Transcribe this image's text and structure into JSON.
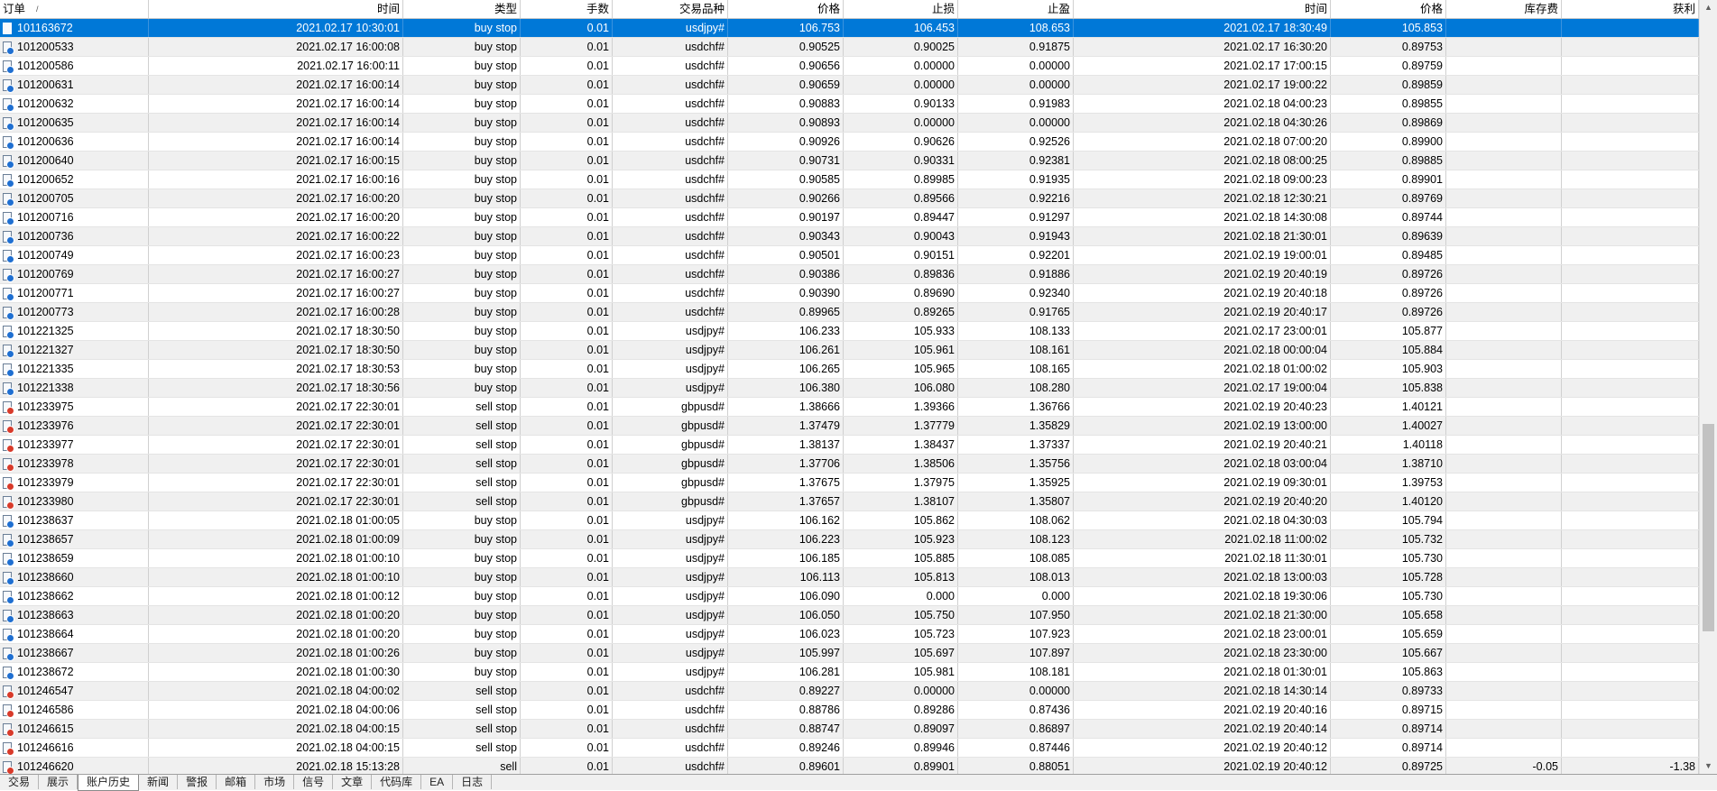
{
  "columns": [
    "订单",
    "时间",
    "类型",
    "手数",
    "交易品种",
    "价格",
    "止损",
    "止盈",
    "时间",
    "价格",
    "库存费",
    "获利"
  ],
  "sort_indicator": "/",
  "sort_icon": "sort-ascending-icon",
  "rows": [
    {
      "order": "101163672",
      "open_time": "2021.02.17 10:30:01",
      "type": "buy stop",
      "lots": "0.01",
      "symbol": "usdjpy#",
      "price": "106.753",
      "sl": "106.453",
      "tp": "108.653",
      "close_time": "2021.02.17 18:30:49",
      "close_price": "105.853",
      "swap": "",
      "profit": "",
      "icon": "none",
      "selected": true
    },
    {
      "order": "101200533",
      "open_time": "2021.02.17 16:00:08",
      "type": "buy stop",
      "lots": "0.01",
      "symbol": "usdchf#",
      "price": "0.90525",
      "sl": "0.90025",
      "tp": "0.91875",
      "close_time": "2021.02.17 16:30:20",
      "close_price": "0.89753",
      "swap": "",
      "profit": "",
      "icon": "buy"
    },
    {
      "order": "101200586",
      "open_time": "2021.02.17 16:00:11",
      "type": "buy stop",
      "lots": "0.01",
      "symbol": "usdchf#",
      "price": "0.90656",
      "sl": "0.00000",
      "tp": "0.00000",
      "close_time": "2021.02.17 17:00:15",
      "close_price": "0.89759",
      "swap": "",
      "profit": "",
      "icon": "buy"
    },
    {
      "order": "101200631",
      "open_time": "2021.02.17 16:00:14",
      "type": "buy stop",
      "lots": "0.01",
      "symbol": "usdchf#",
      "price": "0.90659",
      "sl": "0.00000",
      "tp": "0.00000",
      "close_time": "2021.02.17 19:00:22",
      "close_price": "0.89859",
      "swap": "",
      "profit": "",
      "icon": "buy"
    },
    {
      "order": "101200632",
      "open_time": "2021.02.17 16:00:14",
      "type": "buy stop",
      "lots": "0.01",
      "symbol": "usdchf#",
      "price": "0.90883",
      "sl": "0.90133",
      "tp": "0.91983",
      "close_time": "2021.02.18 04:00:23",
      "close_price": "0.89855",
      "swap": "",
      "profit": "",
      "icon": "buy"
    },
    {
      "order": "101200635",
      "open_time": "2021.02.17 16:00:14",
      "type": "buy stop",
      "lots": "0.01",
      "symbol": "usdchf#",
      "price": "0.90893",
      "sl": "0.00000",
      "tp": "0.00000",
      "close_time": "2021.02.18 04:30:26",
      "close_price": "0.89869",
      "swap": "",
      "profit": "",
      "icon": "buy"
    },
    {
      "order": "101200636",
      "open_time": "2021.02.17 16:00:14",
      "type": "buy stop",
      "lots": "0.01",
      "symbol": "usdchf#",
      "price": "0.90926",
      "sl": "0.90626",
      "tp": "0.92526",
      "close_time": "2021.02.18 07:00:20",
      "close_price": "0.89900",
      "swap": "",
      "profit": "",
      "icon": "buy"
    },
    {
      "order": "101200640",
      "open_time": "2021.02.17 16:00:15",
      "type": "buy stop",
      "lots": "0.01",
      "symbol": "usdchf#",
      "price": "0.90731",
      "sl": "0.90331",
      "tp": "0.92381",
      "close_time": "2021.02.18 08:00:25",
      "close_price": "0.89885",
      "swap": "",
      "profit": "",
      "icon": "buy"
    },
    {
      "order": "101200652",
      "open_time": "2021.02.17 16:00:16",
      "type": "buy stop",
      "lots": "0.01",
      "symbol": "usdchf#",
      "price": "0.90585",
      "sl": "0.89985",
      "tp": "0.91935",
      "close_time": "2021.02.18 09:00:23",
      "close_price": "0.89901",
      "swap": "",
      "profit": "",
      "icon": "buy"
    },
    {
      "order": "101200705",
      "open_time": "2021.02.17 16:00:20",
      "type": "buy stop",
      "lots": "0.01",
      "symbol": "usdchf#",
      "price": "0.90266",
      "sl": "0.89566",
      "tp": "0.92216",
      "close_time": "2021.02.18 12:30:21",
      "close_price": "0.89769",
      "swap": "",
      "profit": "",
      "icon": "buy"
    },
    {
      "order": "101200716",
      "open_time": "2021.02.17 16:00:20",
      "type": "buy stop",
      "lots": "0.01",
      "symbol": "usdchf#",
      "price": "0.90197",
      "sl": "0.89447",
      "tp": "0.91297",
      "close_time": "2021.02.18 14:30:08",
      "close_price": "0.89744",
      "swap": "",
      "profit": "",
      "icon": "buy"
    },
    {
      "order": "101200736",
      "open_time": "2021.02.17 16:00:22",
      "type": "buy stop",
      "lots": "0.01",
      "symbol": "usdchf#",
      "price": "0.90343",
      "sl": "0.90043",
      "tp": "0.91943",
      "close_time": "2021.02.18 21:30:01",
      "close_price": "0.89639",
      "swap": "",
      "profit": "",
      "icon": "buy"
    },
    {
      "order": "101200749",
      "open_time": "2021.02.17 16:00:23",
      "type": "buy stop",
      "lots": "0.01",
      "symbol": "usdchf#",
      "price": "0.90501",
      "sl": "0.90151",
      "tp": "0.92201",
      "close_time": "2021.02.19 19:00:01",
      "close_price": "0.89485",
      "swap": "",
      "profit": "",
      "icon": "buy"
    },
    {
      "order": "101200769",
      "open_time": "2021.02.17 16:00:27",
      "type": "buy stop",
      "lots": "0.01",
      "symbol": "usdchf#",
      "price": "0.90386",
      "sl": "0.89836",
      "tp": "0.91886",
      "close_time": "2021.02.19 20:40:19",
      "close_price": "0.89726",
      "swap": "",
      "profit": "",
      "icon": "buy"
    },
    {
      "order": "101200771",
      "open_time": "2021.02.17 16:00:27",
      "type": "buy stop",
      "lots": "0.01",
      "symbol": "usdchf#",
      "price": "0.90390",
      "sl": "0.89690",
      "tp": "0.92340",
      "close_time": "2021.02.19 20:40:18",
      "close_price": "0.89726",
      "swap": "",
      "profit": "",
      "icon": "buy"
    },
    {
      "order": "101200773",
      "open_time": "2021.02.17 16:00:28",
      "type": "buy stop",
      "lots": "0.01",
      "symbol": "usdchf#",
      "price": "0.89965",
      "sl": "0.89265",
      "tp": "0.91765",
      "close_time": "2021.02.19 20:40:17",
      "close_price": "0.89726",
      "swap": "",
      "profit": "",
      "icon": "buy"
    },
    {
      "order": "101221325",
      "open_time": "2021.02.17 18:30:50",
      "type": "buy stop",
      "lots": "0.01",
      "symbol": "usdjpy#",
      "price": "106.233",
      "sl": "105.933",
      "tp": "108.133",
      "close_time": "2021.02.17 23:00:01",
      "close_price": "105.877",
      "swap": "",
      "profit": "",
      "icon": "buy"
    },
    {
      "order": "101221327",
      "open_time": "2021.02.17 18:30:50",
      "type": "buy stop",
      "lots": "0.01",
      "symbol": "usdjpy#",
      "price": "106.261",
      "sl": "105.961",
      "tp": "108.161",
      "close_time": "2021.02.18 00:00:04",
      "close_price": "105.884",
      "swap": "",
      "profit": "",
      "icon": "buy"
    },
    {
      "order": "101221335",
      "open_time": "2021.02.17 18:30:53",
      "type": "buy stop",
      "lots": "0.01",
      "symbol": "usdjpy#",
      "price": "106.265",
      "sl": "105.965",
      "tp": "108.165",
      "close_time": "2021.02.18 01:00:02",
      "close_price": "105.903",
      "swap": "",
      "profit": "",
      "icon": "buy"
    },
    {
      "order": "101221338",
      "open_time": "2021.02.17 18:30:56",
      "type": "buy stop",
      "lots": "0.01",
      "symbol": "usdjpy#",
      "price": "106.380",
      "sl": "106.080",
      "tp": "108.280",
      "close_time": "2021.02.17 19:00:04",
      "close_price": "105.838",
      "swap": "",
      "profit": "",
      "icon": "buy"
    },
    {
      "order": "101233975",
      "open_time": "2021.02.17 22:30:01",
      "type": "sell stop",
      "lots": "0.01",
      "symbol": "gbpusd#",
      "price": "1.38666",
      "sl": "1.39366",
      "tp": "1.36766",
      "close_time": "2021.02.19 20:40:23",
      "close_price": "1.40121",
      "swap": "",
      "profit": "",
      "icon": "sell"
    },
    {
      "order": "101233976",
      "open_time": "2021.02.17 22:30:01",
      "type": "sell stop",
      "lots": "0.01",
      "symbol": "gbpusd#",
      "price": "1.37479",
      "sl": "1.37779",
      "tp": "1.35829",
      "close_time": "2021.02.19 13:00:00",
      "close_price": "1.40027",
      "swap": "",
      "profit": "",
      "icon": "sell"
    },
    {
      "order": "101233977",
      "open_time": "2021.02.17 22:30:01",
      "type": "sell stop",
      "lots": "0.01",
      "symbol": "gbpusd#",
      "price": "1.38137",
      "sl": "1.38437",
      "tp": "1.37337",
      "close_time": "2021.02.19 20:40:21",
      "close_price": "1.40118",
      "swap": "",
      "profit": "",
      "icon": "sell"
    },
    {
      "order": "101233978",
      "open_time": "2021.02.17 22:30:01",
      "type": "sell stop",
      "lots": "0.01",
      "symbol": "gbpusd#",
      "price": "1.37706",
      "sl": "1.38506",
      "tp": "1.35756",
      "close_time": "2021.02.18 03:00:04",
      "close_price": "1.38710",
      "swap": "",
      "profit": "",
      "icon": "sell"
    },
    {
      "order": "101233979",
      "open_time": "2021.02.17 22:30:01",
      "type": "sell stop",
      "lots": "0.01",
      "symbol": "gbpusd#",
      "price": "1.37675",
      "sl": "1.37975",
      "tp": "1.35925",
      "close_time": "2021.02.19 09:30:01",
      "close_price": "1.39753",
      "swap": "",
      "profit": "",
      "icon": "sell"
    },
    {
      "order": "101233980",
      "open_time": "2021.02.17 22:30:01",
      "type": "sell stop",
      "lots": "0.01",
      "symbol": "gbpusd#",
      "price": "1.37657",
      "sl": "1.38107",
      "tp": "1.35807",
      "close_time": "2021.02.19 20:40:20",
      "close_price": "1.40120",
      "swap": "",
      "profit": "",
      "icon": "sell"
    },
    {
      "order": "101238637",
      "open_time": "2021.02.18 01:00:05",
      "type": "buy stop",
      "lots": "0.01",
      "symbol": "usdjpy#",
      "price": "106.162",
      "sl": "105.862",
      "tp": "108.062",
      "close_time": "2021.02.18 04:30:03",
      "close_price": "105.794",
      "swap": "",
      "profit": "",
      "icon": "buy"
    },
    {
      "order": "101238657",
      "open_time": "2021.02.18 01:00:09",
      "type": "buy stop",
      "lots": "0.01",
      "symbol": "usdjpy#",
      "price": "106.223",
      "sl": "105.923",
      "tp": "108.123",
      "close_time": "2021.02.18 11:00:02",
      "close_price": "105.732",
      "swap": "",
      "profit": "",
      "icon": "buy"
    },
    {
      "order": "101238659",
      "open_time": "2021.02.18 01:00:10",
      "type": "buy stop",
      "lots": "0.01",
      "symbol": "usdjpy#",
      "price": "106.185",
      "sl": "105.885",
      "tp": "108.085",
      "close_time": "2021.02.18 11:30:01",
      "close_price": "105.730",
      "swap": "",
      "profit": "",
      "icon": "buy"
    },
    {
      "order": "101238660",
      "open_time": "2021.02.18 01:00:10",
      "type": "buy stop",
      "lots": "0.01",
      "symbol": "usdjpy#",
      "price": "106.113",
      "sl": "105.813",
      "tp": "108.013",
      "close_time": "2021.02.18 13:00:03",
      "close_price": "105.728",
      "swap": "",
      "profit": "",
      "icon": "buy"
    },
    {
      "order": "101238662",
      "open_time": "2021.02.18 01:00:12",
      "type": "buy stop",
      "lots": "0.01",
      "symbol": "usdjpy#",
      "price": "106.090",
      "sl": "0.000",
      "tp": "0.000",
      "close_time": "2021.02.18 19:30:06",
      "close_price": "105.730",
      "swap": "",
      "profit": "",
      "icon": "buy"
    },
    {
      "order": "101238663",
      "open_time": "2021.02.18 01:00:20",
      "type": "buy stop",
      "lots": "0.01",
      "symbol": "usdjpy#",
      "price": "106.050",
      "sl": "105.750",
      "tp": "107.950",
      "close_time": "2021.02.18 21:30:00",
      "close_price": "105.658",
      "swap": "",
      "profit": "",
      "icon": "buy"
    },
    {
      "order": "101238664",
      "open_time": "2021.02.18 01:00:20",
      "type": "buy stop",
      "lots": "0.01",
      "symbol": "usdjpy#",
      "price": "106.023",
      "sl": "105.723",
      "tp": "107.923",
      "close_time": "2021.02.18 23:00:01",
      "close_price": "105.659",
      "swap": "",
      "profit": "",
      "icon": "buy"
    },
    {
      "order": "101238667",
      "open_time": "2021.02.18 01:00:26",
      "type": "buy stop",
      "lots": "0.01",
      "symbol": "usdjpy#",
      "price": "105.997",
      "sl": "105.697",
      "tp": "107.897",
      "close_time": "2021.02.18 23:30:00",
      "close_price": "105.667",
      "swap": "",
      "profit": "",
      "icon": "buy"
    },
    {
      "order": "101238672",
      "open_time": "2021.02.18 01:00:30",
      "type": "buy stop",
      "lots": "0.01",
      "symbol": "usdjpy#",
      "price": "106.281",
      "sl": "105.981",
      "tp": "108.181",
      "close_time": "2021.02.18 01:30:01",
      "close_price": "105.863",
      "swap": "",
      "profit": "",
      "icon": "buy"
    },
    {
      "order": "101246547",
      "open_time": "2021.02.18 04:00:02",
      "type": "sell stop",
      "lots": "0.01",
      "symbol": "usdchf#",
      "price": "0.89227",
      "sl": "0.00000",
      "tp": "0.00000",
      "close_time": "2021.02.18 14:30:14",
      "close_price": "0.89733",
      "swap": "",
      "profit": "",
      "icon": "sell"
    },
    {
      "order": "101246586",
      "open_time": "2021.02.18 04:00:06",
      "type": "sell stop",
      "lots": "0.01",
      "symbol": "usdchf#",
      "price": "0.88786",
      "sl": "0.89286",
      "tp": "0.87436",
      "close_time": "2021.02.19 20:40:16",
      "close_price": "0.89715",
      "swap": "",
      "profit": "",
      "icon": "sell"
    },
    {
      "order": "101246615",
      "open_time": "2021.02.18 04:00:15",
      "type": "sell stop",
      "lots": "0.01",
      "symbol": "usdchf#",
      "price": "0.88747",
      "sl": "0.89097",
      "tp": "0.86897",
      "close_time": "2021.02.19 20:40:14",
      "close_price": "0.89714",
      "swap": "",
      "profit": "",
      "icon": "sell"
    },
    {
      "order": "101246616",
      "open_time": "2021.02.18 04:00:15",
      "type": "sell stop",
      "lots": "0.01",
      "symbol": "usdchf#",
      "price": "0.89246",
      "sl": "0.89946",
      "tp": "0.87446",
      "close_time": "2021.02.19 20:40:12",
      "close_price": "0.89714",
      "swap": "",
      "profit": "",
      "icon": "sell"
    },
    {
      "order": "101246620",
      "open_time": "2021.02.18 15:13:28",
      "type": "sell",
      "lots": "0.01",
      "symbol": "usdchf#",
      "price": "0.89601",
      "sl": "0.89901",
      "tp": "0.88051",
      "close_time": "2021.02.19 20:40:12",
      "close_price": "0.89725",
      "swap": "-0.05",
      "profit": "-1.38",
      "icon": "sell"
    }
  ],
  "tabs": [
    "交易",
    "展示",
    "账户历史",
    "新闻",
    "警报",
    "邮箱",
    "市场",
    "信号",
    "文章",
    "代码库",
    "EA",
    "日志"
  ],
  "active_tab": "账户历史",
  "colors": {
    "selection": "#0078d7",
    "buy_badge": "#1f6fd1",
    "sell_badge": "#d83a2a"
  }
}
